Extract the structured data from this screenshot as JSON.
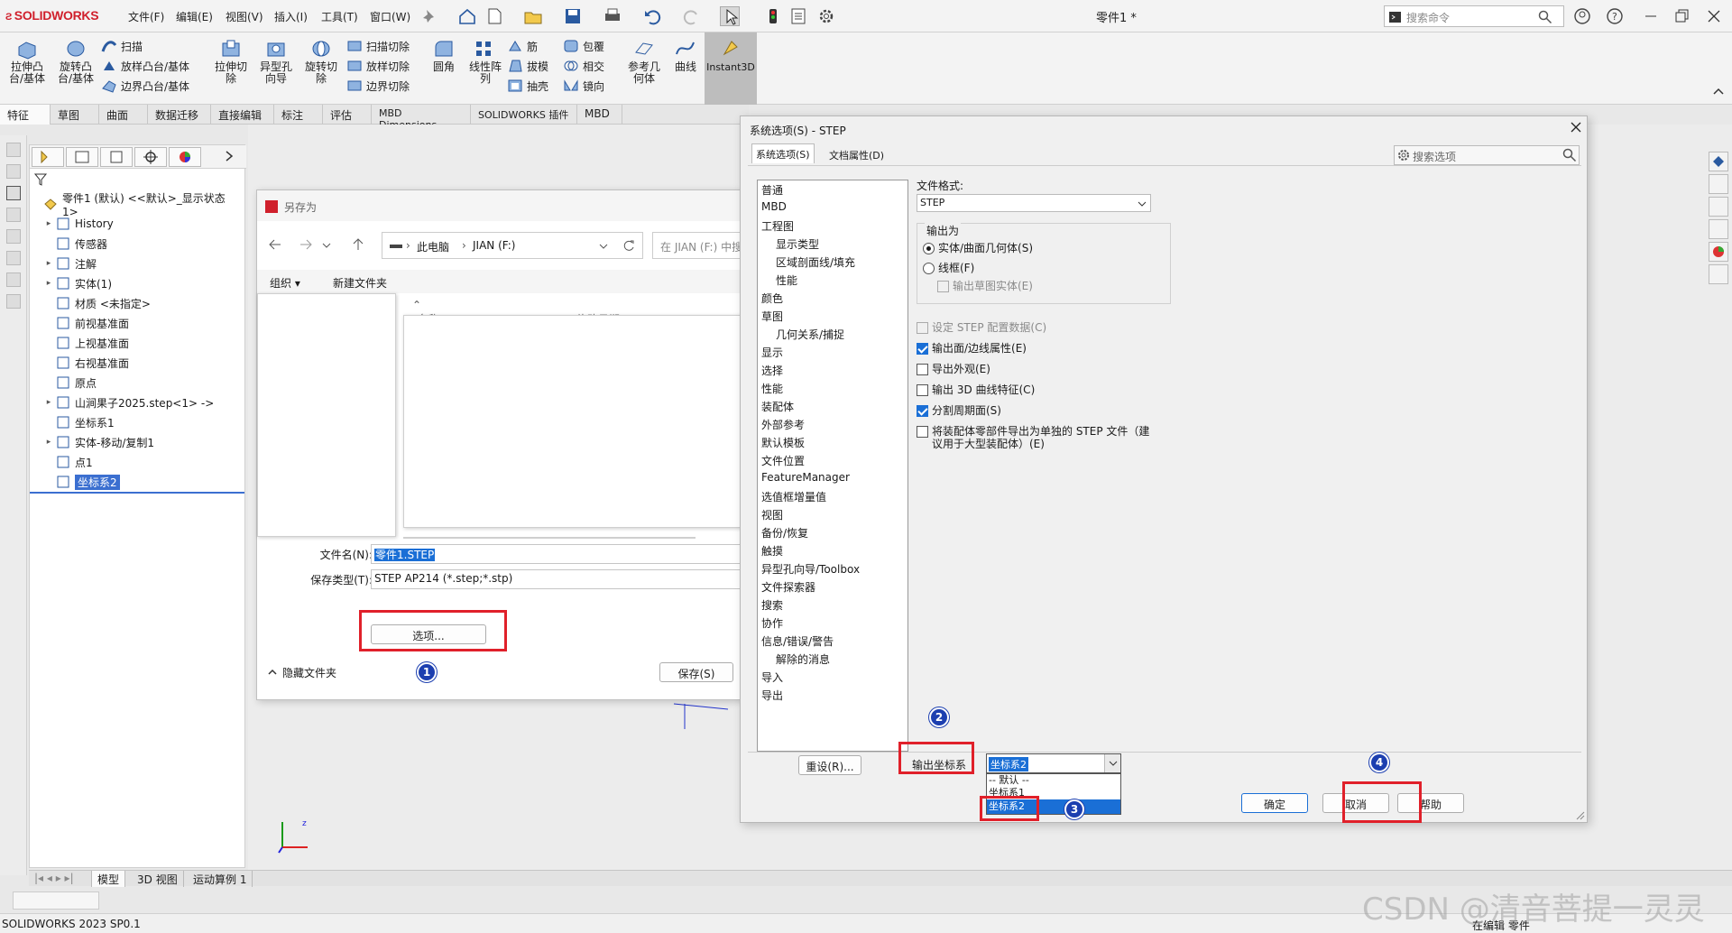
{
  "app": {
    "logo_text": "SOLIDWORKS",
    "document_title": "零件1 *",
    "search_placeholder": "搜索命令",
    "version": "SOLIDWORKS 2023 SP0.1",
    "status_right": "在编辑 零件"
  },
  "menu": [
    "文件(F)",
    "编辑(E)",
    "视图(V)",
    "插入(I)",
    "工具(T)",
    "窗口(W)"
  ],
  "ribbon": {
    "big": [
      {
        "label": "拉伸凸\n台/基体",
        "icon": "extrude-boss-icon"
      },
      {
        "label": "旋转凸\n台/基体",
        "icon": "revolve-boss-icon"
      },
      {
        "label": "拉伸切\n除",
        "icon": "extrude-cut-icon"
      },
      {
        "label": "异型孔\n向导",
        "icon": "hole-wizard-icon"
      },
      {
        "label": "旋转切\n除",
        "icon": "revolve-cut-icon"
      },
      {
        "label": "圆角",
        "icon": "fillet-icon"
      },
      {
        "label": "线性阵\n列",
        "icon": "linear-pattern-icon"
      },
      {
        "label": "参考几\n何体",
        "icon": "reference-geometry-icon"
      },
      {
        "label": "曲线",
        "icon": "curves-icon"
      },
      {
        "label": "Instant3D",
        "icon": "instant3d-icon"
      }
    ],
    "small_col1": [
      "扫描",
      "放样凸台/基体",
      "边界凸台/基体"
    ],
    "small_col2": [
      "扫描切除",
      "放样切除",
      "边界切除"
    ],
    "small_col3": [
      "筋",
      "拔模",
      "抽壳"
    ],
    "small_col4": [
      "包覆",
      "相交",
      "镜向"
    ]
  },
  "tabs": [
    "特征",
    "草图",
    "曲面",
    "数据迁移",
    "直接编辑",
    "标注",
    "评估",
    "MBD Dimensions",
    "SOLIDWORKS 插件",
    "MBD"
  ],
  "feature_tree": {
    "root": "零件1 (默认) <<默认>_显示状态 1>",
    "items": [
      {
        "label": "History",
        "icon": "history-icon",
        "expand": "▸"
      },
      {
        "label": "传感器",
        "icon": "sensor-icon",
        "expand": ""
      },
      {
        "label": "注解",
        "icon": "annotation-icon",
        "expand": "▸"
      },
      {
        "label": "实体(1)",
        "icon": "solid-bodies-icon",
        "expand": "▸"
      },
      {
        "label": "材质 <未指定>",
        "icon": "material-icon",
        "expand": ""
      },
      {
        "label": "前视基准面",
        "icon": "plane-icon",
        "expand": ""
      },
      {
        "label": "上视基准面",
        "icon": "plane-icon",
        "expand": ""
      },
      {
        "label": "右视基准面",
        "icon": "plane-icon",
        "expand": ""
      },
      {
        "label": "原点",
        "icon": "origin-icon",
        "expand": ""
      },
      {
        "label": "山涧果子2025.step<1> ->",
        "icon": "imported-part-icon",
        "expand": "▸"
      },
      {
        "label": "坐标系1",
        "icon": "coordinate-system-icon",
        "expand": ""
      },
      {
        "label": "实体-移动/复制1",
        "icon": "move-copy-icon",
        "expand": "▸"
      },
      {
        "label": "点1",
        "icon": "point-icon",
        "expand": ""
      },
      {
        "label": "坐标系2",
        "icon": "coordinate-system-icon",
        "expand": "",
        "selected": true
      }
    ]
  },
  "bottom_tabs": [
    "模型",
    "3D 视图",
    "运动算例 1"
  ],
  "save_as": {
    "title": "另存为",
    "address": [
      "此电脑",
      "JIAN (F:)"
    ],
    "search_placeholder": "在 JIAN (F:) 中搜",
    "organize": "组织 ▾",
    "new_folder": "新建文件夹",
    "col_name": "名称",
    "col_date": "修改日期",
    "filename_label": "文件名(N):",
    "filename_value": "零件1.STEP",
    "type_label": "保存类型(T):",
    "type_value": "STEP AP214 (*.step;*.stp)",
    "options_button": "选项...",
    "hide_folders": "隐藏文件夹",
    "save_button": "保存(S)"
  },
  "options": {
    "title": "系统选项(S) - STEP",
    "tab_system": "系统选项(S)",
    "tab_document": "文档属性(D)",
    "search_placeholder": "搜索选项",
    "tree": [
      {
        "label": "普通",
        "child": false
      },
      {
        "label": "MBD",
        "child": false
      },
      {
        "label": "工程图",
        "child": false
      },
      {
        "label": "显示类型",
        "child": true
      },
      {
        "label": "区域剖面线/填充",
        "child": true
      },
      {
        "label": "性能",
        "child": true
      },
      {
        "label": "颜色",
        "child": false
      },
      {
        "label": "草图",
        "child": false
      },
      {
        "label": "几何关系/捕捉",
        "child": true
      },
      {
        "label": "显示",
        "child": false
      },
      {
        "label": "选择",
        "child": false
      },
      {
        "label": "性能",
        "child": false
      },
      {
        "label": "装配体",
        "child": false
      },
      {
        "label": "外部参考",
        "child": false
      },
      {
        "label": "默认模板",
        "child": false
      },
      {
        "label": "文件位置",
        "child": false
      },
      {
        "label": "FeatureManager",
        "child": false
      },
      {
        "label": "选值框增量值",
        "child": false
      },
      {
        "label": "视图",
        "child": false
      },
      {
        "label": "备份/恢复",
        "child": false
      },
      {
        "label": "触摸",
        "child": false
      },
      {
        "label": "异型孔向导/Toolbox",
        "child": false
      },
      {
        "label": "文件探索器",
        "child": false
      },
      {
        "label": "搜索",
        "child": false
      },
      {
        "label": "协作",
        "child": false
      },
      {
        "label": "信息/错误/警告",
        "child": false
      },
      {
        "label": "解除的消息",
        "child": true
      },
      {
        "label": "导入",
        "child": false
      },
      {
        "label": "导出",
        "child": false
      }
    ],
    "file_format_label": "文件格式:",
    "file_format_value": "STEP",
    "output_as_label": "输出为",
    "radio_solid": "实体/曲面几何体(S)",
    "radio_wire": "线框(F)",
    "check_sketch": "输出草图实体(E)",
    "check_step_config": "设定 STEP 配置数据(C)",
    "check_face_edge": "输出面/边线属性(E)",
    "check_appearance": "导出外观(E)",
    "check_3d_curve": "输出 3D 曲线特征(C)",
    "check_split": "分割周期面(S)",
    "check_assembly_1": "将装配体零部件导出为单独的 STEP 文件（建",
    "check_assembly_2": "议用于大型装配体）(E)",
    "reset_button": "重设(R)...",
    "coord_label": "输出坐标系",
    "coord_value": "坐标系2",
    "coord_options": [
      "-- 默认 --",
      "坐标系1",
      "坐标系2"
    ],
    "ok_button": "确定",
    "cancel_button": "取消",
    "help_button": "帮助"
  },
  "annotations": [
    "1",
    "2",
    "3",
    "4"
  ],
  "watermark": "CSDN @清音菩提一灵灵",
  "colors": {
    "accent_red": "#e0202a",
    "badge_blue": "#1c3fb0",
    "selection_blue": "#1a6fd6",
    "logo_red": "#d0202c"
  }
}
